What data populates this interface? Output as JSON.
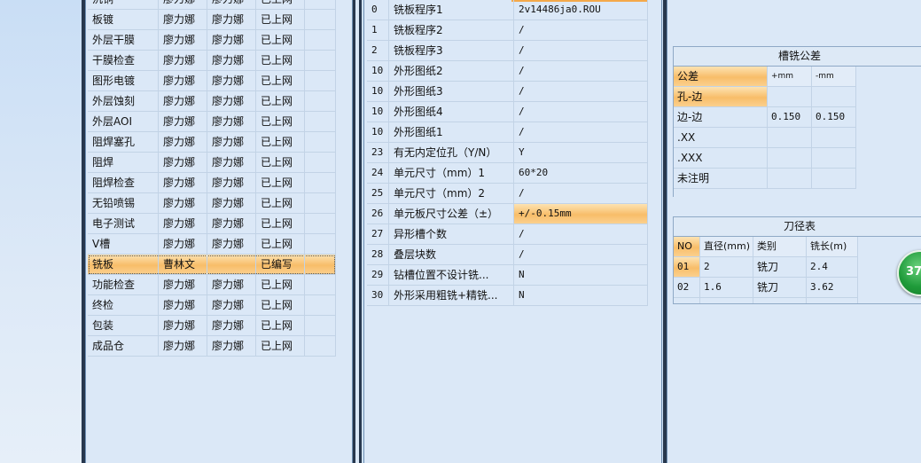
{
  "process_list": {
    "rows": [
      {
        "name": "沉铜",
        "c1": "廖力娜",
        "c2": "廖力娜",
        "status": "已上网"
      },
      {
        "name": "板镀",
        "c1": "廖力娜",
        "c2": "廖力娜",
        "status": "已上网"
      },
      {
        "name": "外层干膜",
        "c1": "廖力娜",
        "c2": "廖力娜",
        "status": "已上网"
      },
      {
        "name": "干膜检查",
        "c1": "廖力娜",
        "c2": "廖力娜",
        "status": "已上网"
      },
      {
        "name": "图形电镀",
        "c1": "廖力娜",
        "c2": "廖力娜",
        "status": "已上网"
      },
      {
        "name": "外层蚀刻",
        "c1": "廖力娜",
        "c2": "廖力娜",
        "status": "已上网"
      },
      {
        "name": "外层AOI",
        "c1": "廖力娜",
        "c2": "廖力娜",
        "status": "已上网"
      },
      {
        "name": "阻焊塞孔",
        "c1": "廖力娜",
        "c2": "廖力娜",
        "status": "已上网"
      },
      {
        "name": "阻焊",
        "c1": "廖力娜",
        "c2": "廖力娜",
        "status": "已上网"
      },
      {
        "name": "阻焊检查",
        "c1": "廖力娜",
        "c2": "廖力娜",
        "status": "已上网"
      },
      {
        "name": "无铅喷锡",
        "c1": "廖力娜",
        "c2": "廖力娜",
        "status": "已上网"
      },
      {
        "name": "电子测试",
        "c1": "廖力娜",
        "c2": "廖力娜",
        "status": "已上网"
      },
      {
        "name": "V槽",
        "c1": "廖力娜",
        "c2": "廖力娜",
        "status": "已上网"
      },
      {
        "name": "铣板",
        "c1": "曹林文",
        "c2": "",
        "status": "已编写"
      },
      {
        "name": "功能检查",
        "c1": "廖力娜",
        "c2": "廖力娜",
        "status": "已上网"
      },
      {
        "name": "终检",
        "c1": "廖力娜",
        "c2": "廖力娜",
        "status": "已上网"
      },
      {
        "name": "包装",
        "c1": "廖力娜",
        "c2": "廖力娜",
        "status": "已上网"
      },
      {
        "name": "成品仓",
        "c1": "廖力娜",
        "c2": "廖力娜",
        "status": "已上网"
      }
    ],
    "selected_index": 13
  },
  "params": {
    "rows": [
      {
        "no": "0",
        "name": "铣板程序1",
        "value": "2v14486ja0.ROU"
      },
      {
        "no": "1",
        "name": "铣板程序2",
        "value": "/"
      },
      {
        "no": "2",
        "name": "铣板程序3",
        "value": "/"
      },
      {
        "no": "10",
        "name": "外形图纸2",
        "value": "/"
      },
      {
        "no": "10",
        "name": "外形图纸3",
        "value": "/"
      },
      {
        "no": "10",
        "name": "外形图纸4",
        "value": "/"
      },
      {
        "no": "10",
        "name": "外形图纸1",
        "value": "/"
      },
      {
        "no": "23",
        "name": "有无内定位孔（Y/N）",
        "value": "Y"
      },
      {
        "no": "24",
        "name": "单元尺寸（mm）1",
        "value": "60*20"
      },
      {
        "no": "25",
        "name": "单元尺寸（mm）2",
        "value": "/"
      },
      {
        "no": "26",
        "name": "单元板尺寸公差（±）",
        "value": "+/-0.15mm"
      },
      {
        "no": "27",
        "name": "异形槽个数",
        "value": "/"
      },
      {
        "no": "28",
        "name": "叠层块数",
        "value": "/"
      },
      {
        "no": "29",
        "name": "钻槽位置不设计铣...",
        "value": "N"
      },
      {
        "no": "30",
        "name": "外形采用粗铣+精铣...",
        "value": "N"
      }
    ],
    "selected_index": 10
  },
  "tolerance": {
    "title": "槽铣公差",
    "headers": [
      "公差",
      "+mm",
      "-mm"
    ],
    "rows": [
      {
        "label": "孔-边",
        "plus": "",
        "minus": ""
      },
      {
        "label": "边-边",
        "plus": "0.150",
        "minus": "0.150"
      },
      {
        "label": ".XX",
        "plus": "",
        "minus": ""
      },
      {
        "label": ".XXX",
        "plus": "",
        "minus": ""
      },
      {
        "label": "未注明",
        "plus": "",
        "minus": ""
      }
    ]
  },
  "tools": {
    "title": "刀径表",
    "headers": [
      "NO",
      "直径(mm)",
      "类别",
      "铣长(m)"
    ],
    "rows": [
      {
        "no": "01",
        "dia": "2",
        "type": "铣刀",
        "len": "2.4"
      },
      {
        "no": "02",
        "dia": "1.6",
        "type": "铣刀",
        "len": "3.62"
      }
    ]
  },
  "badge": {
    "text": "37"
  },
  "colors": {
    "highlight": "#f8bd69",
    "background": "#dbe8f7",
    "grid": "#c2d3e6"
  }
}
